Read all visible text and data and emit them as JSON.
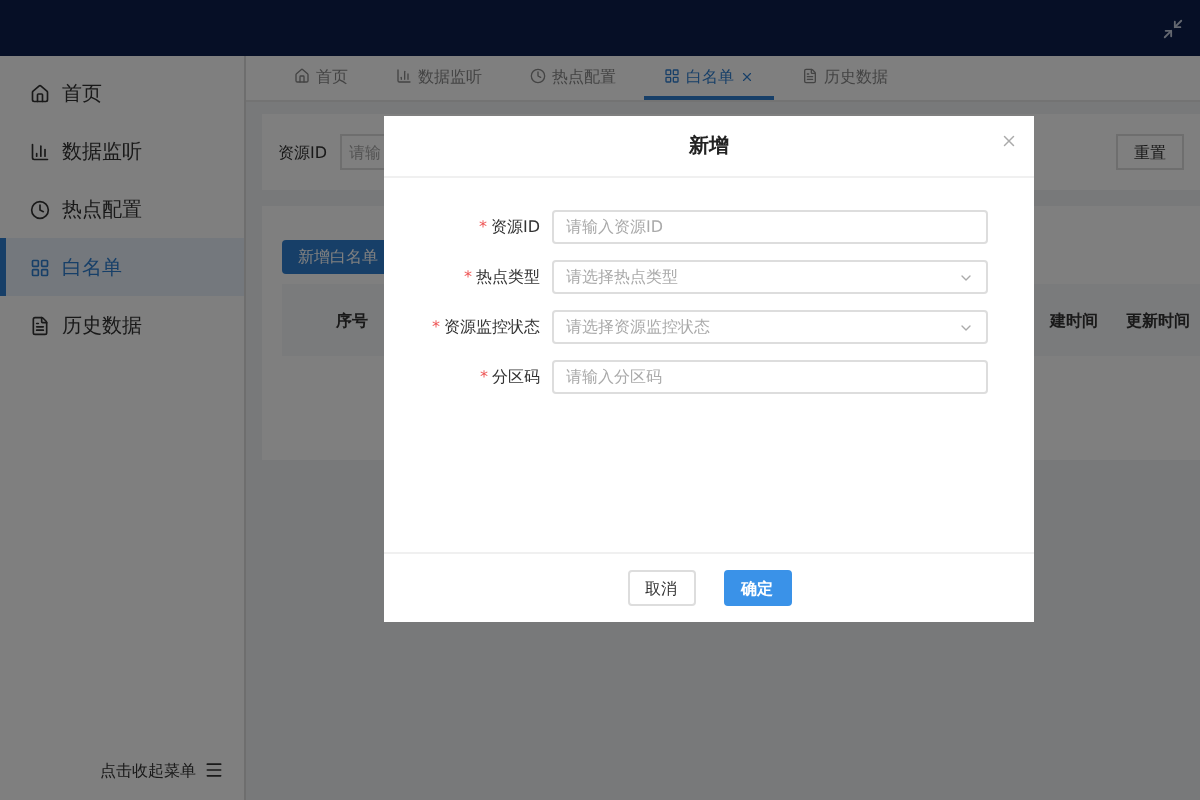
{
  "sidebar": {
    "items": [
      {
        "label": "首页",
        "selected": false
      },
      {
        "label": "数据监听",
        "selected": false
      },
      {
        "label": "热点配置",
        "selected": false
      },
      {
        "label": "白名单",
        "selected": true
      },
      {
        "label": "历史数据",
        "selected": false
      }
    ],
    "collapse": "点击收起菜单"
  },
  "tabs": [
    {
      "label": "首页",
      "selected": false,
      "closable": false
    },
    {
      "label": "数据监听",
      "selected": false,
      "closable": false
    },
    {
      "label": "热点配置",
      "selected": false,
      "closable": false
    },
    {
      "label": "白名单",
      "selected": true,
      "closable": true
    },
    {
      "label": "历史数据",
      "selected": false,
      "closable": false
    }
  ],
  "search": {
    "label": "资源ID",
    "placeholder": "请输",
    "reset": "重置"
  },
  "table": {
    "add_button": "新增白名单",
    "columns": [
      "序号",
      "建时间",
      "更新时间"
    ]
  },
  "dialog": {
    "title": "新增",
    "fields": [
      {
        "label": "资源ID",
        "kind": "input",
        "placeholder": "请输入资源ID",
        "required_mark": "*"
      },
      {
        "label": "热点类型",
        "kind": "select",
        "placeholder": "请选择热点类型",
        "required_mark": "*"
      },
      {
        "label": "资源监控状态",
        "kind": "select",
        "placeholder": "请选择资源监控状态",
        "required_mark": "*"
      },
      {
        "label": "分区码",
        "kind": "input",
        "placeholder": "请输入分区码",
        "required_mark": "*"
      }
    ],
    "buttons": [
      {
        "label": "取消",
        "primary": false
      },
      {
        "label": "确定",
        "primary": true
      }
    ]
  }
}
